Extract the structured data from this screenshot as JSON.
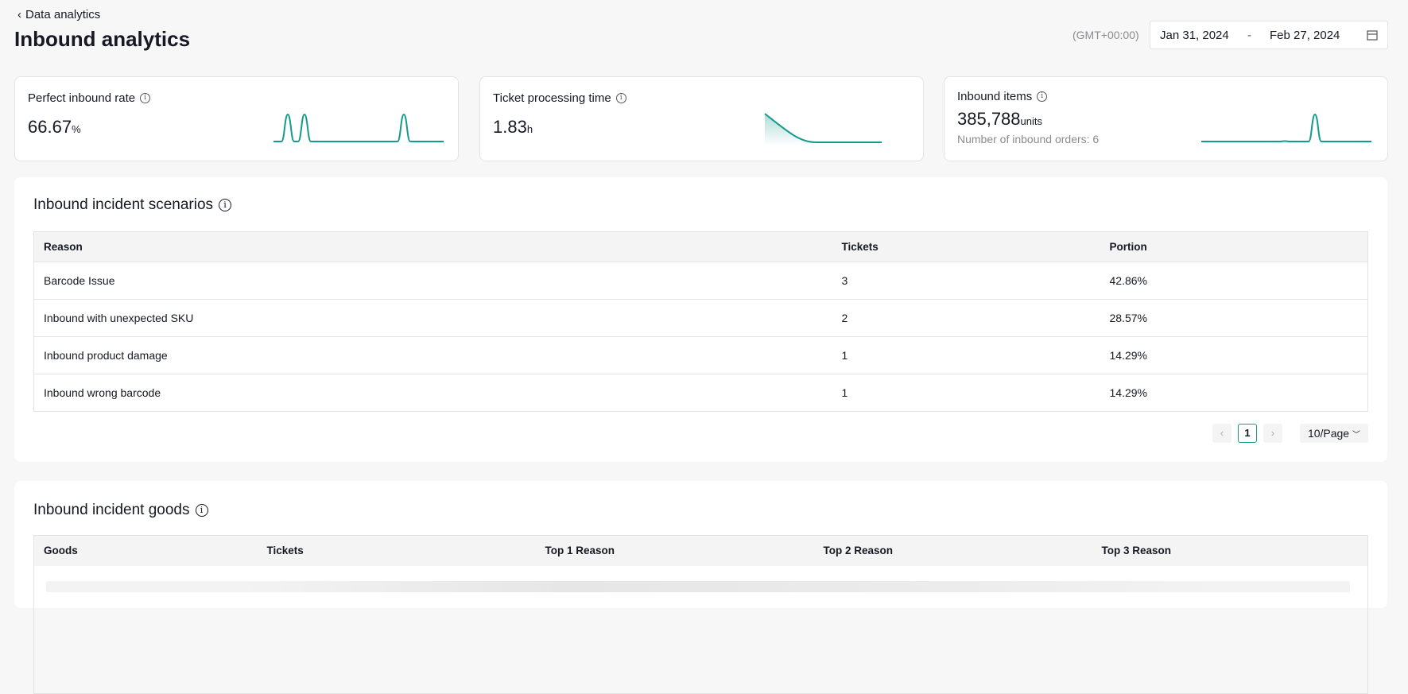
{
  "header": {
    "back_label": "Data analytics",
    "title": "Inbound analytics",
    "timezone": "(GMT+00:00)",
    "date_start": "Jan 31, 2024",
    "date_sep": "-",
    "date_end": "Feb 27, 2024"
  },
  "cards": [
    {
      "label": "Perfect inbound rate",
      "value": "66.67",
      "unit": "%"
    },
    {
      "label": "Ticket processing time",
      "value": "1.83",
      "unit": "h"
    },
    {
      "label": "Inbound items",
      "value": "385,788",
      "unit": "units",
      "sub": "Number of inbound orders: 6"
    }
  ],
  "scenarios": {
    "title": "Inbound incident scenarios",
    "columns": [
      "Reason",
      "Tickets",
      "Portion"
    ],
    "rows": [
      [
        "Barcode Issue",
        "3",
        "42.86%"
      ],
      [
        "Inbound with unexpected SKU",
        "2",
        "28.57%"
      ],
      [
        "Inbound product damage",
        "1",
        "14.29%"
      ],
      [
        "Inbound wrong barcode",
        "1",
        "14.29%"
      ]
    ],
    "page": "1",
    "page_size": "10/Page"
  },
  "goods": {
    "title": "Inbound incident goods",
    "columns": [
      "Goods",
      "Tickets",
      "Top 1 Reason",
      "Top 2 Reason",
      "Top 3 Reason"
    ]
  },
  "colors": {
    "accent": "#159a8c"
  }
}
